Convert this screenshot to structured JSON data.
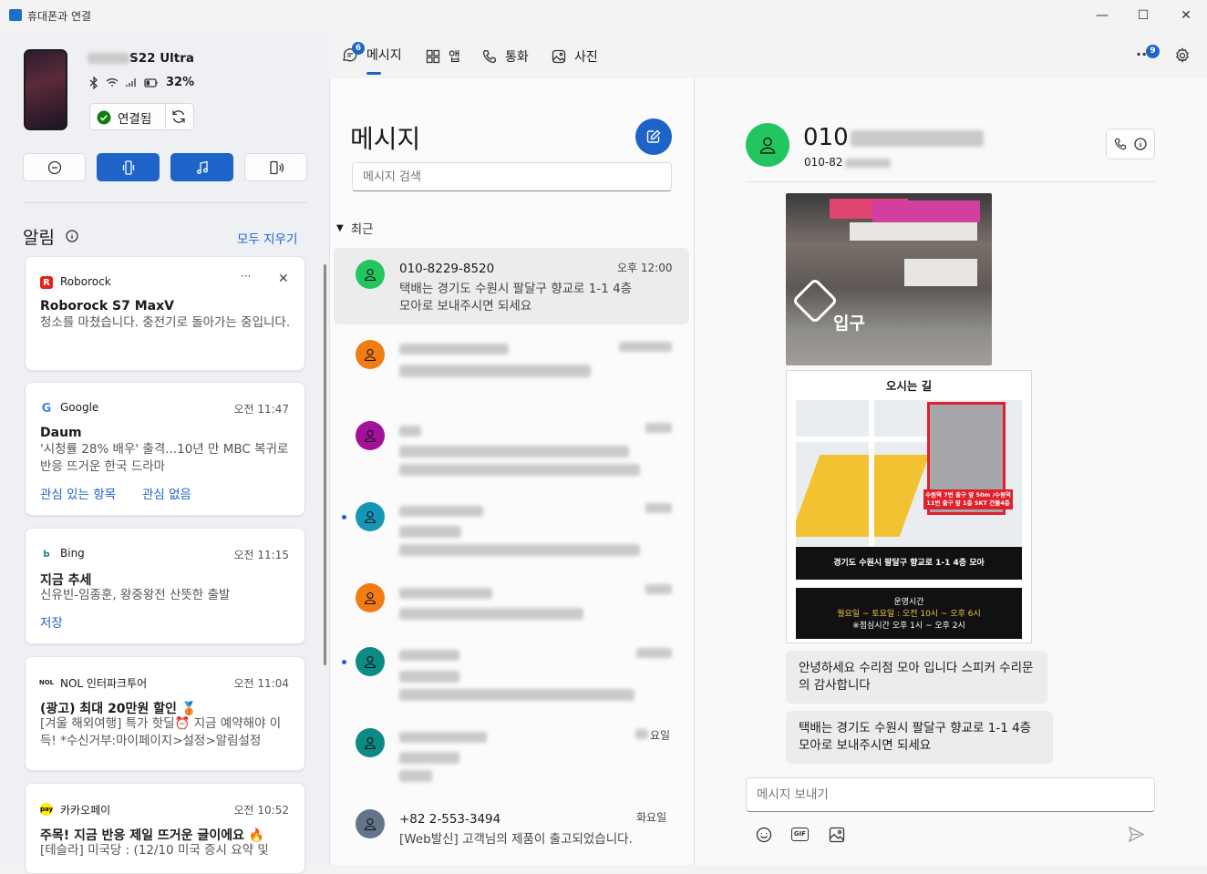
{
  "window": {
    "title": "휴대폰과 연결",
    "minimize": "—",
    "maximize": "☐",
    "close": "✕"
  },
  "device": {
    "name_suffix": "S22 Ultra",
    "battery": "32%",
    "status": "연결됨"
  },
  "tabs": [
    {
      "label": "메시지",
      "badge": "6",
      "icon": "message-icon"
    },
    {
      "label": "앱",
      "icon": "apps-icon"
    },
    {
      "label": "통화",
      "icon": "phone-icon"
    },
    {
      "label": "사진",
      "icon": "photo-icon"
    }
  ],
  "header": {
    "more_badge": "9"
  },
  "notifications": {
    "title": "알림",
    "clear_all": "모두 지우기",
    "items": [
      {
        "app": "Roborock",
        "title": "Roborock S7 MaxV",
        "body": "청소를 마쳤습니다. 충전기로 돌아가는 중입니다.",
        "time": "",
        "more": "···",
        "close": "✕"
      },
      {
        "app": "Google",
        "time": "오전 11:47",
        "title": "Daum",
        "body": "'시청률 28% 배우' 출격...10년 만 MBC 복귀로 반응 뜨거운 한국 드라마",
        "action1": "관심 있는 항목",
        "action2": "관심 없음"
      },
      {
        "app": "Bing",
        "time": "오전 11:15",
        "title": "지금 추세",
        "body": "신유빈-임종훈, 왕중왕전 산뜻한 출발",
        "action1": "저장"
      },
      {
        "app": "NOL 인터파크투어",
        "time": "오전 11:04",
        "title": "(광고) 최대 20만원 할인 🥉",
        "body": "[겨울 해외여행] 특가 핫딜⏰ 지금 예약해야 이득! *수신거부:마이페이지>설정>알림설정"
      },
      {
        "app": "카카오페이",
        "time": "오전 10:52",
        "title": "주목! 지금 반응 제일 뜨거운 글이에요 🔥",
        "body": "[테슬라] 미국당 : (12/10 미국 증시 요약 및"
      }
    ]
  },
  "messages": {
    "title": "메시지",
    "search_placeholder": "메시지 검색",
    "section": "최근",
    "conversations": [
      {
        "name": "010-8229-8520",
        "time": "오후 12:00",
        "preview": "택배는 경기도 수원시 팔달구 향교로 1-1 4층 모아로 보내주시면 되세요",
        "color": "#22c55e"
      },
      {
        "name": "",
        "time": "",
        "preview": "",
        "color": "#f27c14"
      },
      {
        "name": "",
        "time": "",
        "preview": "",
        "color": "#a3119a"
      },
      {
        "name": "",
        "time": "",
        "preview": "",
        "color": "#1496b4"
      },
      {
        "name": "",
        "time": "",
        "preview": "",
        "color": "#f27c14"
      },
      {
        "name": "",
        "time": "",
        "preview": "",
        "color": "#0e8a84"
      },
      {
        "name": "",
        "time": "요일",
        "preview": "",
        "color": "#0e8a84"
      },
      {
        "name": "+82 2-553-3494",
        "time": "화요일",
        "preview": "[Web발신] 고객님의 제품이 출고되었습니다.",
        "color": "#64748b"
      }
    ]
  },
  "conversation": {
    "contact_prefix": "010",
    "contact_sub": "010-82",
    "image": {
      "entrance_label": "입구",
      "title": "오시는 길",
      "map_caption": "수원역 7번 출구 앞 50m /수원역 11번 출구 앞 1층 SKT 건물4층",
      "address_bar": "경기도 수원시 팔달구 향교로 1-1 4층 모아",
      "hours_title": "운영시간",
      "hours": "월요일 ~ 토요일 : 오전 10시 ~ 오후 6시",
      "break": "※점심시간 오후 1시 ~ 오후 2시"
    },
    "bubbles": [
      "안녕하세요 수리점 모아 입니다 스피커 수리문의 감사합니다",
      "택배는 경기도 수원시 팔달구 향교로 1-1 4층 모아로 보내주시면 되세요"
    ],
    "compose_placeholder": "메시지 보내기",
    "gif_label": "GIF"
  }
}
